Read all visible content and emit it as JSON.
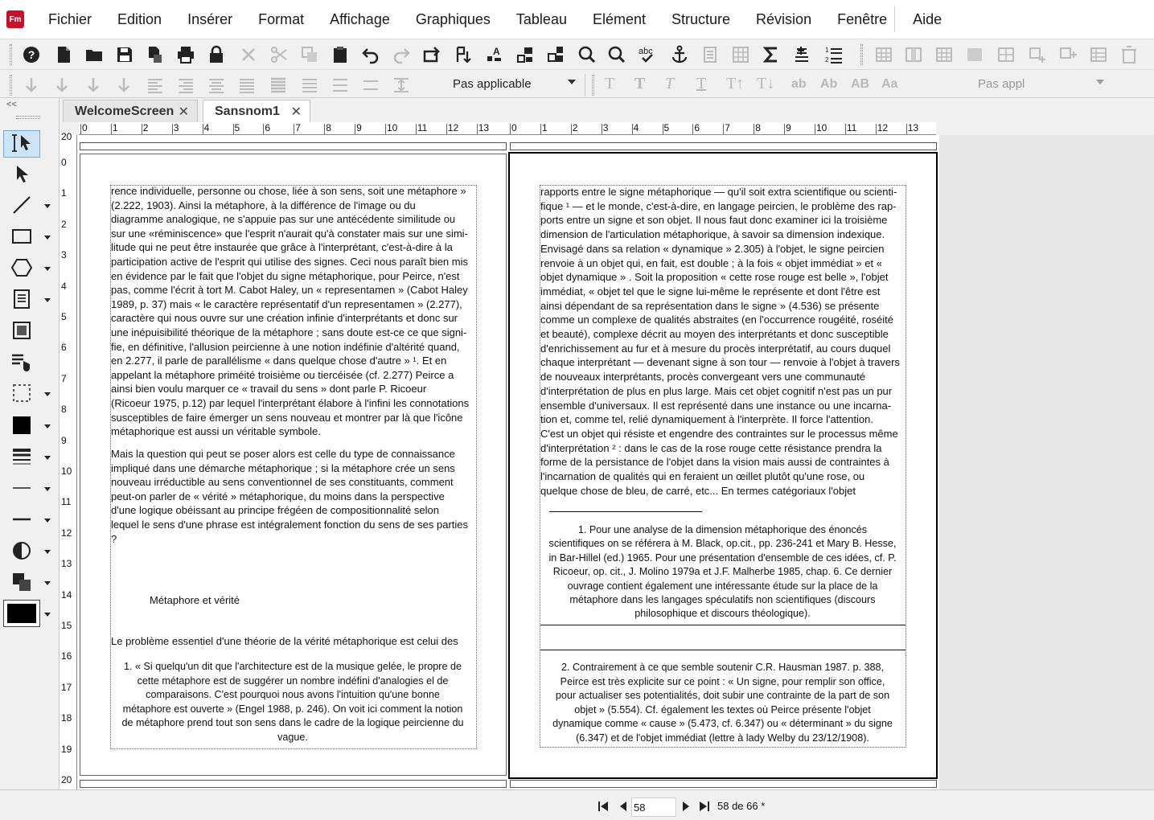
{
  "app": {
    "logo_text": "Fm"
  },
  "menu": [
    "Fichier",
    "Edition",
    "Insérer",
    "Format",
    "Affichage",
    "Graphiques",
    "Tableau",
    "Elément",
    "Structure",
    "Révision",
    "Fenêtre",
    "Aide"
  ],
  "toolbar": {
    "paragraph_format": "Pas applicable",
    "character_format": "Pas appl",
    "char_letters": [
      "T",
      "T",
      "T",
      "T",
      "T↑",
      "T↓",
      "ab",
      "Ab",
      "AB",
      "Aa"
    ]
  },
  "palette": {
    "collapse_label": "<<"
  },
  "tabs": [
    {
      "label": "WelcomeScreen",
      "close": "✕"
    },
    {
      "label": "Sansnom1",
      "close": "✕"
    }
  ],
  "ruler": {
    "h_left": [
      "0",
      "1",
      "2",
      "3",
      "4",
      "5",
      "6",
      "7",
      "8",
      "9",
      "10",
      "11",
      "12",
      "13"
    ],
    "h_right": [
      "0",
      "1",
      "2",
      "3",
      "4",
      "5",
      "6",
      "7",
      "8",
      "9",
      "10",
      "11",
      "12",
      "13"
    ],
    "v": [
      "20",
      "0",
      "1",
      "2",
      "3",
      "4",
      "5",
      "6",
      "7",
      "8",
      "9",
      "10",
      "11",
      "12",
      "13",
      "14",
      "15",
      "16",
      "17",
      "18",
      "19",
      "20"
    ]
  },
  "left_page": {
    "body": [
      "rence individuelle, personne ou chose, liée à son sens, soit une métaphore »",
      "(2.222, 1903). Ainsi la métaphore, à la différence de l'image ou du",
      "diagramme analogique, ne s'appuie  pas  sur une antécédente similitude ou",
      "sur une «réminiscence» que l'esprit n'aurait qu'à constater mais sur une simi-",
      "litude qui ne peut être instaurée que grâce à l'interprétant, c'est-à-dire à la",
      "participation active de l'esprit qui utilise des signes. Ceci nous paraît bien mis",
      "en évidence par le fait que l'objet du signe métaphorique, pour Peirce, n'est",
      "pas, comme l'écrit à tort M. Cabot Haley, un « representamen » (Cabot Haley",
      "1989, p. 37) mais « le caractère représentatif d'un representamen » (2.277),",
      "caractère qui nous ouvre sur une création infinie d'interprétants et donc sur",
      "une inépuisibilité théorique de la métaphore ; sans doute est-ce ce que signi-",
      "fie, en définitive, l'allusion peircienne à une notion indéfinie d'altérité quand,",
      "en 2.277, il parle de parallélisme «  dans quelque chose d'autre » ¹. Et en",
      "appelant la métaphore priméité troisième ou tiercéisée (cf. 2.277) Peirce a",
      "ainsi bien voulu  marquer  ce  « travail du sens »  dont parle P. Ricoeur",
      "(Ricoeur 1975, p.12) par lequel l'interprétant élabore à l'infini les connotations",
      "susceptibles de faire émerger un sens nouveau et montrer par là que l'icône",
      "métaphorique est aussi un véritable symbole."
    ],
    "body2": [
      "Mais la question qui peut se poser alors est celle du type de connaissance",
      "impliqué dans une démarche métaphorique ; si la métaphore crée un sens",
      "nouveau irréductible au sens conventionnel de ses constituants, comment",
      "peut-on parler de « vérité » métaphorique, du moins dans la perspective",
      "d'une logique obéissant au principe frégéen de compositionnalité selon",
      "lequel le sens d'une phrase est intégralement fonction du sens de ses parties",
      "?"
    ],
    "heading": "Métaphore et vérité",
    "line_after_heading": "Le problème essentiel d'une théorie de la vérité métaphorique est celui des",
    "footnote": [
      "1. « Si quelqu'un dit que l'architecture est de la musique gelée, le propre de",
      "cette métaphore est de suggérer un nombre indéfini d'analogies el de",
      "comparaisons. C'est pourquoi nous avons l'intuition qu'une bonne",
      "métaphore est ouverte » (Engel 1988, p. 246). On voit ici comment la notion",
      "de métaphore prend tout son sens dans le cadre de la logique peircienne du",
      "vague."
    ]
  },
  "right_page": {
    "body": [
      "rapports entre le signe métaphorique — qu'il soit extra scientifique ou scienti-",
      "fique ¹ — et le monde, c'est-à-dire, en langage peircien, le problème des rap-",
      "ports entre un signe et son objet. Il nous faut donc examiner ici la troisième",
      "dimension de l'articulation métaphorique, à savoir sa dimension indexique.",
      "Envisagé dans sa relation «  dynamique » 2.305) à l'objet, le signe peircien",
      "renvoie à un objet qui, en fait, est double ; à la fois « objet immédiat » et «",
      "objet dynamique » . Soit  la proposition « cette rose rouge est belle », l'objet",
      "immédiat, «  objet tel que le signe lui-même le représente et dont l'être est",
      "ainsi dépendant de sa représentation dans le signe » (4.536) se présente",
      "comme un complexe de qualités abstraites (en l'occurrence rougéité, roséité",
      "et beauté), complexe décrit au moyen des interprétants et donc susceptible",
      "d'enrichissement au fur et à mesure du procès interprétatif, au cours duquel",
      "chaque interprétant — devenant signe à son tour — renvoie à l'objet à travers",
      "de nouveaux interprétants, procès convergeant vers une communauté",
      "d'interprétation de plus en plus large. Mais cet objet cognitif n'est pas un pur",
      "ensemble d'universaux. Il est représenté dans une instance ou une incarna-",
      "tion et, comme tel, relié dynamiquement à l'interprète. Il force l'attention.",
      "C'est un objet qui résiste et engendre des contraintes sur le processus même",
      "d'interprétation ² : dans le cas de la rose rouge cette résistance prendra la",
      "forme de la persistance de l'objet dans la vision mais aussi de contraintes à",
      "l'incarnation de qualités qui en feraient un œillet plutôt qu'une rose, ou",
      "quelque chose de bleu, de carré, etc... En termes catégoriaux l'objet"
    ],
    "footnote1": [
      "1. Pour une analyse de la dimension métaphorique des énoncés",
      "scientifiques on se référera à M. Black, op.cit., pp. 236-241 et Mary B. Hesse,",
      "in Bar-Hillel (ed.) 1965. Pour une présentation d'ensemble de ces idées, cf. P.",
      "Ricoeur, op. cit., J. Molino 1979a et J.F. Malherbe 1985, chap. 6. Ce dernier",
      "ouvrage contient également une intéressante étude sur la place de la",
      "métaphore dans les langages spéculatifs non scientifiques (discours",
      "philosophique et discours théologique)."
    ],
    "footnote2": [
      "2. Contrairement à ce que semble soutenir C.R. Hausman 1987. p. 388,",
      "Peirce est très explicite sur ce point : « Un signe, pour remplir son office,",
      "pour actualiser ses potentialités, doit subir une contrainte de la part de son",
      "objet » (5.554). Cf. également les textes où Peirce présente l'objet",
      "dynamique comme « cause » (5.473, cf. 6.347) ou « déterminant » du signe",
      "(6.347) et de l'objet immédiat (lettre à lady Welby du 23/12/1908)."
    ]
  },
  "status": {
    "current_page": "58",
    "page_count": "58 de 66 *"
  }
}
